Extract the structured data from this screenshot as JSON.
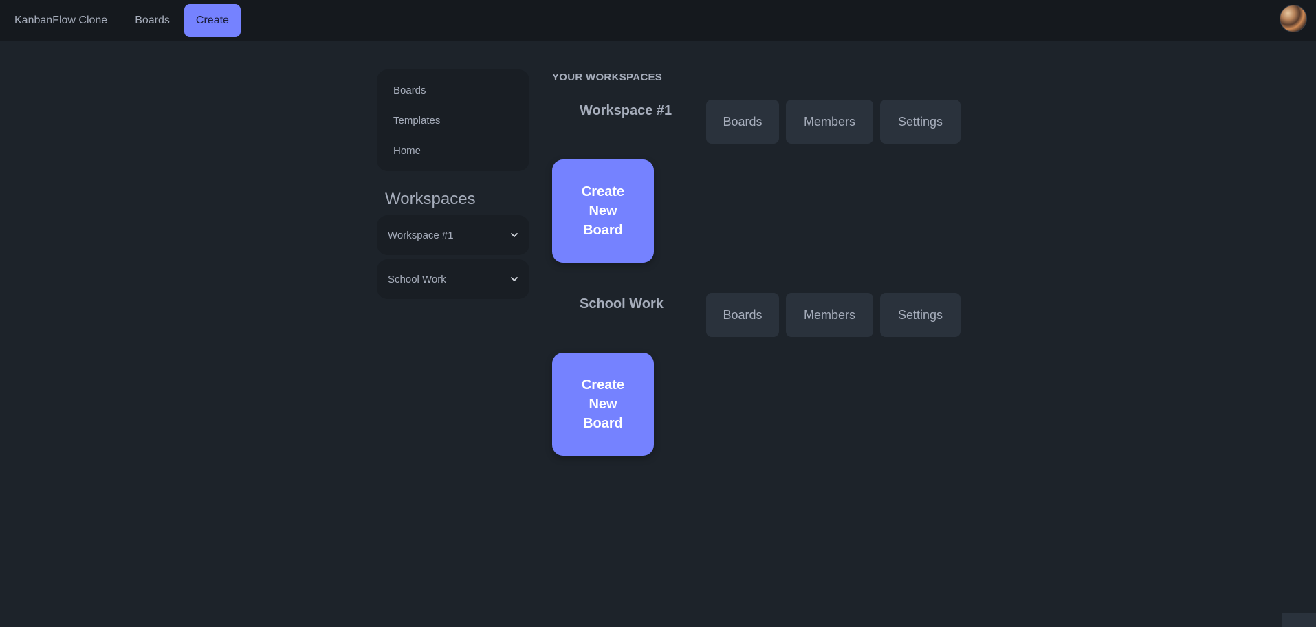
{
  "navbar": {
    "brand": "KanbanFlow Clone",
    "boards_label": "Boards",
    "create_label": "Create"
  },
  "sidebar": {
    "items": [
      {
        "label": "Boards"
      },
      {
        "label": "Templates"
      },
      {
        "label": "Home"
      }
    ],
    "workspaces_heading": "Workspaces",
    "workspaces": [
      {
        "label": "Workspace #1"
      },
      {
        "label": "School Work"
      }
    ]
  },
  "main": {
    "heading": "YOUR WORKSPACES",
    "workspaces": [
      {
        "title": "Workspace #1",
        "buttons": {
          "boards": "Boards",
          "members": "Members",
          "settings": "Settings"
        },
        "create_card": "Create New Board"
      },
      {
        "title": "School Work",
        "buttons": {
          "boards": "Boards",
          "members": "Members",
          "settings": "Settings"
        },
        "create_card": "Create New Board"
      }
    ]
  },
  "colors": {
    "background": "#1d232a",
    "navbar": "#15191e",
    "accent": "#7582ff",
    "button": "#2a323c",
    "text": "#a6adbb"
  },
  "icons": {
    "avatar": "user-avatar",
    "chevron": "chevron-down-icon"
  }
}
